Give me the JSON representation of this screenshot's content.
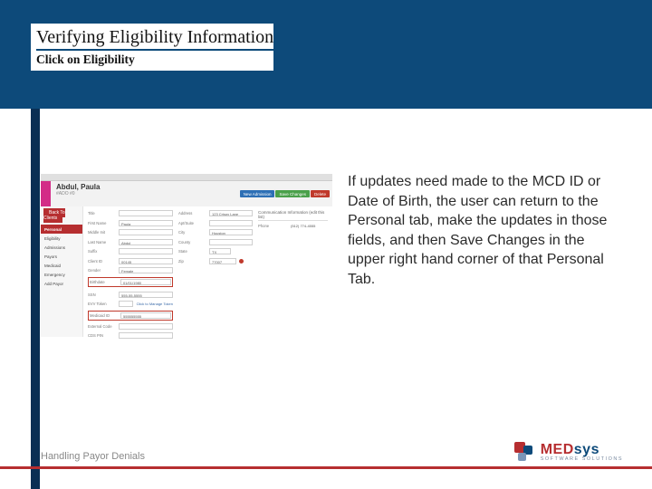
{
  "header": {
    "title": "Verifying Eligibility Information",
    "subtitle": "Click on Eligibility"
  },
  "body_text": "If updates need made to the MCD ID or Date of Birth, the user can return to the Personal tab, make the updates in those fields, and then Save Changes in the upper right hand corner of that Personal Tab.",
  "footer": {
    "text": "Handling Payor Denials",
    "logo_main_a": "MED",
    "logo_main_b": "sys",
    "logo_sub": "SOFTWARE SOLUTIONS"
  },
  "app": {
    "back_btn": "Back To Clients",
    "patient_name": "Abdul, Paula",
    "patient_sub": "#ADO #0",
    "hdr_btns": {
      "new_admission": "New Admission",
      "save": "Save Changes",
      "delete": "Delete"
    },
    "tabs": [
      "Personal",
      "Eligibility",
      "Admissions",
      "Payors",
      "Medicaid",
      "Emergency",
      "Add Payor"
    ],
    "comm_header": "Communication Information (edit this list)",
    "labels": {
      "title": "Title",
      "first_name": "First Name",
      "middle": "Middle Init",
      "last_name": "Last Name",
      "suffix": "Suffix",
      "client_id": "Client ID",
      "gender": "Gender",
      "birthdate": "Birthdate",
      "address": "Address",
      "apt": "Apt/Suite",
      "city": "City",
      "county": "County",
      "state": "State",
      "zip": "Zip",
      "ssn": "SSN",
      "evv": "EVV Token",
      "medicaid": "Medicaid ID",
      "external": "External Code",
      "cds": "CDS PIN",
      "phone": "Phone"
    },
    "values": {
      "title": "",
      "first_name": "Paula",
      "middle": "",
      "last_name": "Abdul",
      "suffix": "",
      "client_id": "00145",
      "gender": "Female",
      "birthdate": "01/01/1980",
      "address": "123 Crispy Lane",
      "apt": "",
      "city": "Houston",
      "county": "",
      "state": "TX",
      "zip": "77007",
      "ssn": "555-55-5555",
      "evv": "",
      "medicaid": "555555555",
      "external": "",
      "cds": "",
      "phone": "(512) 774-4555"
    },
    "token_link": "Click to Manage Token"
  }
}
